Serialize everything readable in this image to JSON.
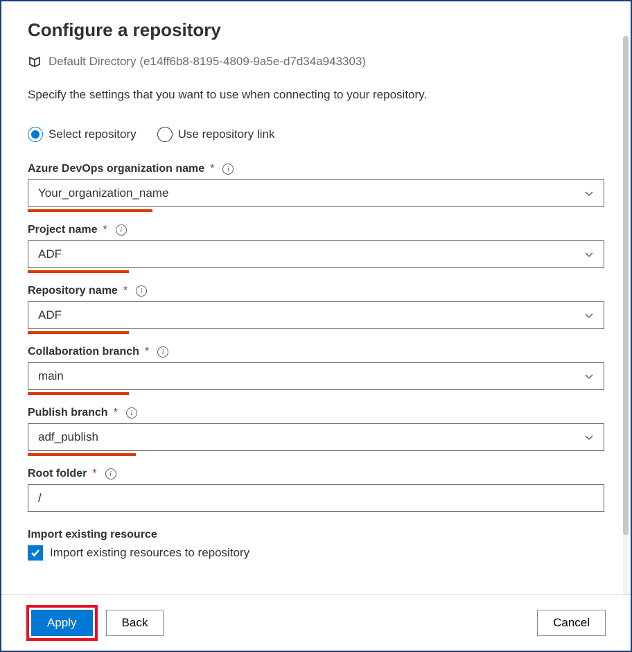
{
  "header": {
    "title": "Configure a repository",
    "directory": "Default Directory (e14ff6b8-8195-4809-9a5e-d7d34a943303)",
    "instruction": "Specify the settings that you want to use when connecting to your repository."
  },
  "radio": {
    "select_label": "Select repository",
    "link_label": "Use repository link"
  },
  "fields": {
    "org": {
      "label": "Azure DevOps organization name",
      "value": "Your_organization_name"
    },
    "project": {
      "label": "Project name",
      "value": "ADF"
    },
    "repo": {
      "label": "Repository name",
      "value": "ADF"
    },
    "collab": {
      "label": "Collaboration branch",
      "value": "main"
    },
    "publish": {
      "label": "Publish branch",
      "value": "adf_publish"
    },
    "root": {
      "label": "Root folder",
      "value": "/"
    }
  },
  "import": {
    "heading": "Import existing resource",
    "checkbox_label": "Import existing resources to repository"
  },
  "footer": {
    "apply": "Apply",
    "back": "Back",
    "cancel": "Cancel"
  }
}
